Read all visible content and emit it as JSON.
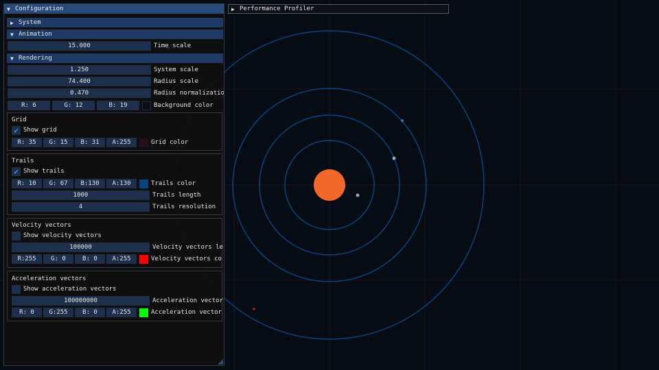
{
  "scene": {
    "grid_color": "#23101f",
    "trail_color": "#0a4382",
    "sun_color": "#f2682a",
    "planet_color": "#9aa7b8",
    "comet_color": "#8a2020"
  },
  "profiler": {
    "title": "Performance Profiler"
  },
  "config": {
    "title": "Configuration",
    "system": {
      "header": "System"
    },
    "animation": {
      "header": "Animation",
      "time_scale_value": "15.000",
      "time_scale_label": "Time scale"
    },
    "rendering": {
      "header": "Rendering",
      "system_scale_value": "1.250",
      "system_scale_label": "System scale",
      "radius_scale_value": "74.400",
      "radius_scale_label": "Radius scale",
      "radius_norm_value": "0.470",
      "radius_norm_label": "Radius normalization",
      "bg": {
        "r": "R:  6",
        "g": "G: 12",
        "b": "B: 19",
        "label": "Background color",
        "swatch": "#060c13"
      }
    },
    "grid": {
      "title": "Grid",
      "show_label": "Show grid",
      "r": "R: 35",
      "g": "G: 15",
      "b": "B: 31",
      "a": "A:255",
      "color_label": "Grid color",
      "swatch": "#230f1f"
    },
    "trails": {
      "title": "Trails",
      "show_label": "Show trails",
      "r": "R: 10",
      "g": "G: 67",
      "b": "B:130",
      "a": "A:130",
      "color_label": "Trails color",
      "swatch": "#0a4382",
      "length_value": "1000",
      "length_label": "Trails length",
      "res_value": "4",
      "res_label": "Trails resolution"
    },
    "velocity": {
      "title": "Velocity vectors",
      "show_label": "Show velocity vectors",
      "value": "100000",
      "value_label": "Velocity vectors le",
      "r": "R:255",
      "g": "G:  0",
      "b": "B:  0",
      "a": "A:255",
      "color_label": "Velocity vectors co",
      "swatch": "#ff0000"
    },
    "acceleration": {
      "title": "Acceleration vectors",
      "show_label": "Show acceleration vectors",
      "value": "100000000",
      "value_label": "Acceleration vector",
      "r": "R:  0",
      "g": "G:255",
      "b": "B:  0",
      "a": "A:255",
      "color_label": "Acceleration vector",
      "swatch": "#00ff00"
    }
  }
}
